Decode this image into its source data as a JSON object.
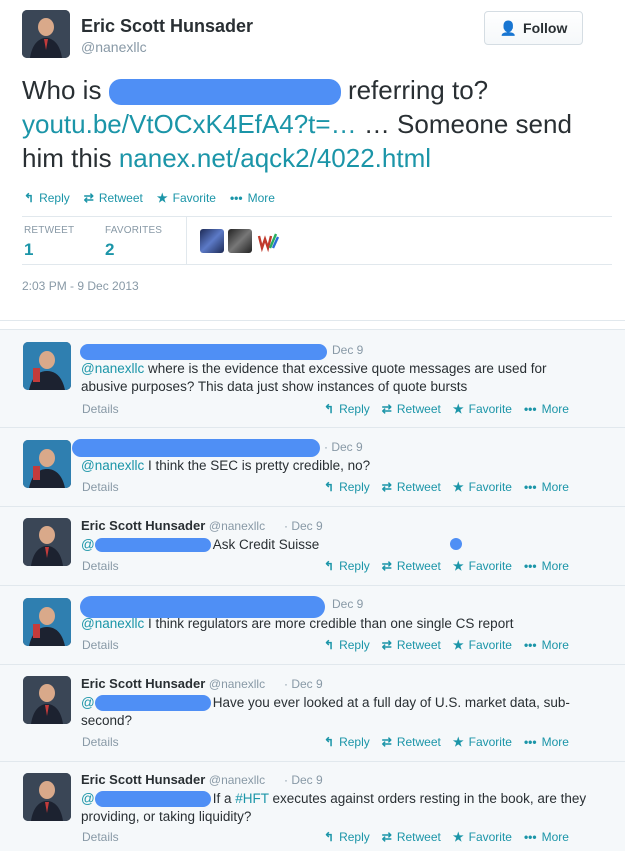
{
  "main_tweet": {
    "author_name": "Eric Scott Hunsader",
    "author_handle": "@nanexllc",
    "follow_label": "Follow",
    "text_before": "Who is",
    "text_after": "referring to?",
    "link1": "youtu.be/VtOCxK4EfA4?t=…",
    "text_mid": "… Someone send him this",
    "link2": "nanex.net/aqck2/4022.html",
    "actions": {
      "reply": "Reply",
      "retweet": "Retweet",
      "favorite": "Favorite",
      "more": "More"
    },
    "stats": {
      "retweet_label": "RETWEET",
      "retweet_count": "1",
      "favorites_label": "FAVORITES",
      "favorites_count": "2"
    },
    "timestamp": "2:03 PM - 9 Dec 2013"
  },
  "replies": [
    {
      "name": "",
      "handle": "",
      "time": "Dec 9",
      "mention": "@nanexllc",
      "text": " where is the evidence that excessive quote messages are used for abusive purposes? This data just show instances of quote bursts",
      "details": "Details"
    },
    {
      "name": "",
      "handle": "",
      "time": "· Dec 9",
      "mention": "@nanexllc",
      "text": " I think the SEC is pretty credible, no?",
      "details": "Details"
    },
    {
      "name": "Eric Scott Hunsader",
      "handle": "@nanexllc",
      "time": "· Dec 9",
      "mention": "@",
      "text": "Ask Credit Suisse",
      "details": "Details"
    },
    {
      "name": "",
      "handle": "",
      "time": "Dec 9",
      "mention": "@nanexllc",
      "text": " I think regulators are more credible than one single CS report",
      "details": "Details"
    },
    {
      "name": "Eric Scott Hunsader",
      "handle": "@nanexllc",
      "time": "· Dec 9",
      "mention": "@",
      "text": "Have you ever looked at a full day of U.S. market data, sub-second?",
      "details": "Details"
    },
    {
      "name": "Eric Scott Hunsader",
      "handle": "@nanexllc",
      "time": "· Dec 9",
      "mention": "@",
      "text_before": "If a ",
      "hashtag": "#HFT",
      "text": " executes against orders resting in the book, are they providing, or taking liquidity?",
      "details": "Details"
    }
  ],
  "icons": {
    "reply": "reply-arrow-icon",
    "retweet": "retweet-icon",
    "favorite": "star-icon",
    "more": "ellipsis-icon",
    "follow": "add-user-icon"
  },
  "colors": {
    "link": "#1b95a8",
    "redaction": "#4f8ff5",
    "muted": "#8899a6",
    "reply_bg": "#f5f8fa"
  }
}
